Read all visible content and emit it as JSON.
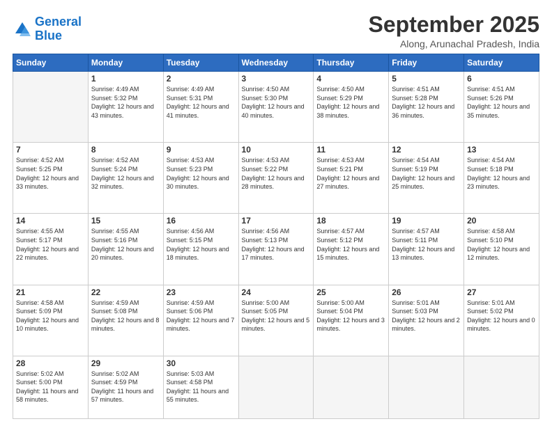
{
  "logo": {
    "line1": "General",
    "line2": "Blue"
  },
  "header": {
    "month": "September 2025",
    "location": "Along, Arunachal Pradesh, India"
  },
  "days_of_week": [
    "Sunday",
    "Monday",
    "Tuesday",
    "Wednesday",
    "Thursday",
    "Friday",
    "Saturday"
  ],
  "weeks": [
    [
      {
        "num": "",
        "empty": true
      },
      {
        "num": "1",
        "rise": "4:49 AM",
        "set": "5:32 PM",
        "daylight": "12 hours and 43 minutes"
      },
      {
        "num": "2",
        "rise": "4:49 AM",
        "set": "5:31 PM",
        "daylight": "12 hours and 41 minutes"
      },
      {
        "num": "3",
        "rise": "4:50 AM",
        "set": "5:30 PM",
        "daylight": "12 hours and 40 minutes"
      },
      {
        "num": "4",
        "rise": "4:50 AM",
        "set": "5:29 PM",
        "daylight": "12 hours and 38 minutes"
      },
      {
        "num": "5",
        "rise": "4:51 AM",
        "set": "5:28 PM",
        "daylight": "12 hours and 36 minutes"
      },
      {
        "num": "6",
        "rise": "4:51 AM",
        "set": "5:26 PM",
        "daylight": "12 hours and 35 minutes"
      }
    ],
    [
      {
        "num": "7",
        "rise": "4:52 AM",
        "set": "5:25 PM",
        "daylight": "12 hours and 33 minutes"
      },
      {
        "num": "8",
        "rise": "4:52 AM",
        "set": "5:24 PM",
        "daylight": "12 hours and 32 minutes"
      },
      {
        "num": "9",
        "rise": "4:53 AM",
        "set": "5:23 PM",
        "daylight": "12 hours and 30 minutes"
      },
      {
        "num": "10",
        "rise": "4:53 AM",
        "set": "5:22 PM",
        "daylight": "12 hours and 28 minutes"
      },
      {
        "num": "11",
        "rise": "4:53 AM",
        "set": "5:21 PM",
        "daylight": "12 hours and 27 minutes"
      },
      {
        "num": "12",
        "rise": "4:54 AM",
        "set": "5:19 PM",
        "daylight": "12 hours and 25 minutes"
      },
      {
        "num": "13",
        "rise": "4:54 AM",
        "set": "5:18 PM",
        "daylight": "12 hours and 23 minutes"
      }
    ],
    [
      {
        "num": "14",
        "rise": "4:55 AM",
        "set": "5:17 PM",
        "daylight": "12 hours and 22 minutes"
      },
      {
        "num": "15",
        "rise": "4:55 AM",
        "set": "5:16 PM",
        "daylight": "12 hours and 20 minutes"
      },
      {
        "num": "16",
        "rise": "4:56 AM",
        "set": "5:15 PM",
        "daylight": "12 hours and 18 minutes"
      },
      {
        "num": "17",
        "rise": "4:56 AM",
        "set": "5:13 PM",
        "daylight": "12 hours and 17 minutes"
      },
      {
        "num": "18",
        "rise": "4:57 AM",
        "set": "5:12 PM",
        "daylight": "12 hours and 15 minutes"
      },
      {
        "num": "19",
        "rise": "4:57 AM",
        "set": "5:11 PM",
        "daylight": "12 hours and 13 minutes"
      },
      {
        "num": "20",
        "rise": "4:58 AM",
        "set": "5:10 PM",
        "daylight": "12 hours and 12 minutes"
      }
    ],
    [
      {
        "num": "21",
        "rise": "4:58 AM",
        "set": "5:09 PM",
        "daylight": "12 hours and 10 minutes"
      },
      {
        "num": "22",
        "rise": "4:59 AM",
        "set": "5:08 PM",
        "daylight": "12 hours and 8 minutes"
      },
      {
        "num": "23",
        "rise": "4:59 AM",
        "set": "5:06 PM",
        "daylight": "12 hours and 7 minutes"
      },
      {
        "num": "24",
        "rise": "5:00 AM",
        "set": "5:05 PM",
        "daylight": "12 hours and 5 minutes"
      },
      {
        "num": "25",
        "rise": "5:00 AM",
        "set": "5:04 PM",
        "daylight": "12 hours and 3 minutes"
      },
      {
        "num": "26",
        "rise": "5:01 AM",
        "set": "5:03 PM",
        "daylight": "12 hours and 2 minutes"
      },
      {
        "num": "27",
        "rise": "5:01 AM",
        "set": "5:02 PM",
        "daylight": "12 hours and 0 minutes"
      }
    ],
    [
      {
        "num": "28",
        "rise": "5:02 AM",
        "set": "5:00 PM",
        "daylight": "11 hours and 58 minutes"
      },
      {
        "num": "29",
        "rise": "5:02 AM",
        "set": "4:59 PM",
        "daylight": "11 hours and 57 minutes"
      },
      {
        "num": "30",
        "rise": "5:03 AM",
        "set": "4:58 PM",
        "daylight": "11 hours and 55 minutes"
      },
      {
        "num": "",
        "empty": true
      },
      {
        "num": "",
        "empty": true
      },
      {
        "num": "",
        "empty": true
      },
      {
        "num": "",
        "empty": true
      }
    ]
  ]
}
